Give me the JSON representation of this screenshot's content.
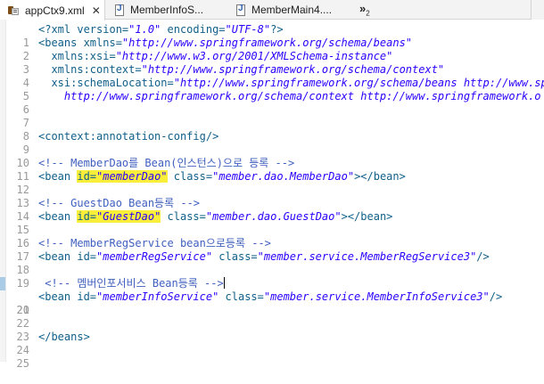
{
  "tabs": [
    {
      "label": "appCtx9.xml",
      "close": "✕"
    },
    {
      "label": "MemberInfoS..."
    },
    {
      "label": "MemberMain4...."
    }
  ],
  "overflow": {
    "glyph": "»",
    "count": "2"
  },
  "editor": {
    "l1_num": "1",
    "l1_a": "<?xml version=",
    "l1_b": "\"1.0\"",
    "l1_c": " encoding=",
    "l1_d": "\"UTF-8\"",
    "l1_e": "?>",
    "l2_num": "2",
    "l2_a": "<beans xmlns=",
    "l2_b": "\"http://www.springframework.org/schema/beans\"",
    "l3_num": "3",
    "l3_a": "  xmlns:xsi=",
    "l3_b": "\"http://www.w3.org/2001/XMLSchema-instance\"",
    "l4_num": "4",
    "l4_a": "  xmlns:context=",
    "l4_b": "\"http://www.springframework.org/schema/context\"",
    "l5_num": "5",
    "l5_a": "  xsi:schemaLocation=",
    "l5_b": "\"http://www.springframework.org/schema/beans http://www.sp",
    "l6_num": "6",
    "l6_b": "    http://www.springframework.org/schema/context http://www.springframework.o",
    "l7_num": "7",
    "l8_num": "8",
    "l9_num": "9",
    "l9_a": "<context:annotation-config/>",
    "l10_num": "10",
    "l11_num": "11",
    "l11_a": "<!-- MemberDao를 Bean(인스턴스)으로 등록 -->",
    "l12_num": "12",
    "l12_a": "<bean ",
    "l12_b": "id=",
    "l12_c": "\"memberDao\"",
    "l12_d": " class=",
    "l12_e": "\"member.dao.MemberDao\"",
    "l12_f": "></bean>",
    "l13_num": "13",
    "l14_num": "14",
    "l14_a": "<!-- GuestDao Bean등록 -->",
    "l15_num": "15",
    "l15_a": "<bean ",
    "l15_b": "id=",
    "l15_c": "\"GuestDao\"",
    "l15_d": " class=",
    "l15_e": "\"member.dao.GuestDao\"",
    "l15_f": "></bean>",
    "l16_num": "16",
    "l17_num": "17",
    "l17_a": "<!-- MemberRegService bean으로등록 -->",
    "l18_num": "18",
    "l18_a": "<bean id=",
    "l18_b": "\"memberRegService\"",
    "l18_c": " class=",
    "l18_d": "\"member.service.MemberRegService3\"",
    "l18_e": "/>",
    "l19_num": "19",
    "l20_num": "20",
    "l20_a": " <!-- 멤버인포서비스 Bean등록 -->",
    "l21_num": "21",
    "l21_a": "<bean id=",
    "l21_b": "\"memberInfoService\"",
    "l21_c": " class=",
    "l21_d": "\"member.service.MemberInfoService3\"",
    "l21_e": "/>",
    "l22_num": "22",
    "l23_num": "23",
    "l24_num": "24",
    "l24_a": "</beans>",
    "l25_num": "25"
  }
}
